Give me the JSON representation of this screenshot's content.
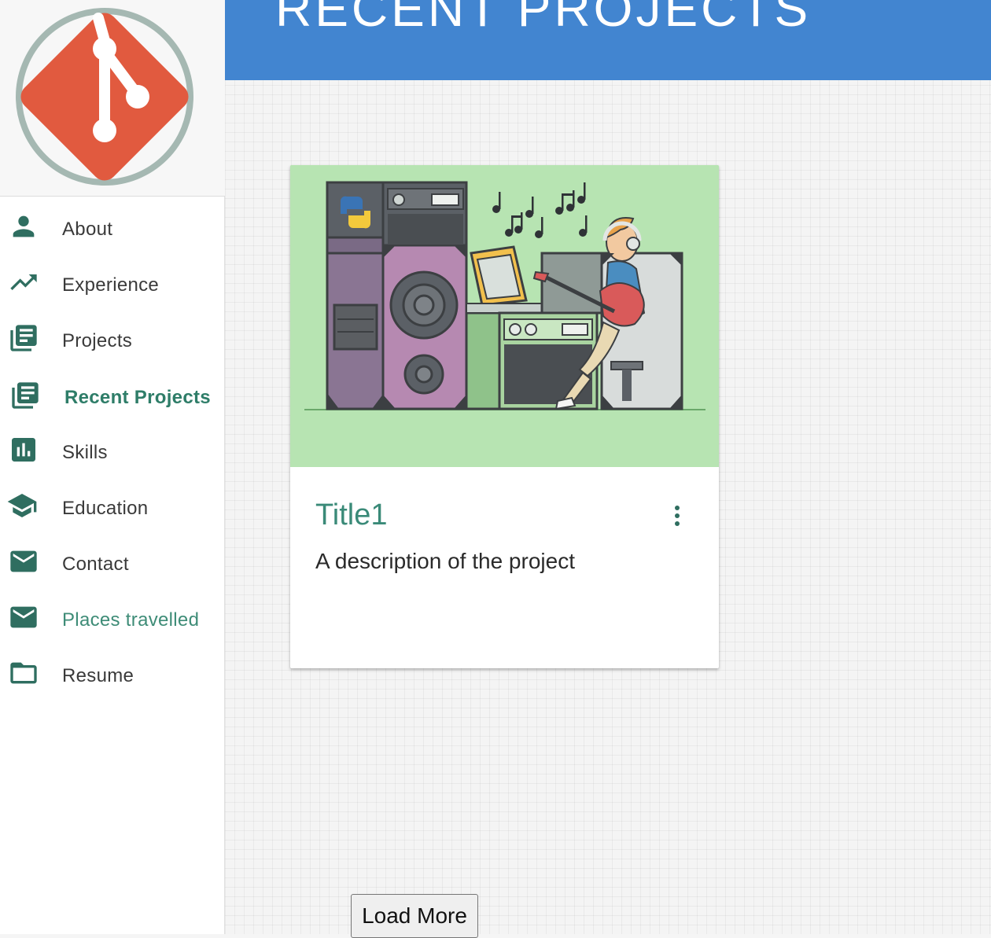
{
  "sidebar": {
    "logo": {
      "icon": "git-logo-icon",
      "colors": {
        "ring": "#a5b8b2",
        "diamond": "#e15a3f"
      }
    },
    "nav": [
      {
        "label": "About",
        "icon": "person-icon"
      },
      {
        "label": "Experience",
        "icon": "trending-up-icon"
      },
      {
        "label": "Projects",
        "icon": "library-books-icon"
      },
      {
        "label": "Recent Projects",
        "icon": "library-books-icon",
        "active": true
      },
      {
        "label": "Skills",
        "icon": "bar-chart-icon"
      },
      {
        "label": "Education",
        "icon": "school-icon"
      },
      {
        "label": "Contact",
        "icon": "mail-icon"
      },
      {
        "label": "Places travelled",
        "icon": "mail-icon"
      },
      {
        "label": "Resume",
        "icon": "folder-icon"
      }
    ]
  },
  "header": {
    "title": "RECENT PROJECTS"
  },
  "cards": [
    {
      "title": "Title1",
      "description": "A description of the project",
      "image": "music-studio-illustration",
      "menu_icon": "more-vert-icon"
    }
  ],
  "load_more": {
    "label": "Load More"
  },
  "colors": {
    "header": "#4285d0",
    "accent": "#2e7d68",
    "card_title": "#3a8a78",
    "media_bg": "#b7e4b2"
  }
}
